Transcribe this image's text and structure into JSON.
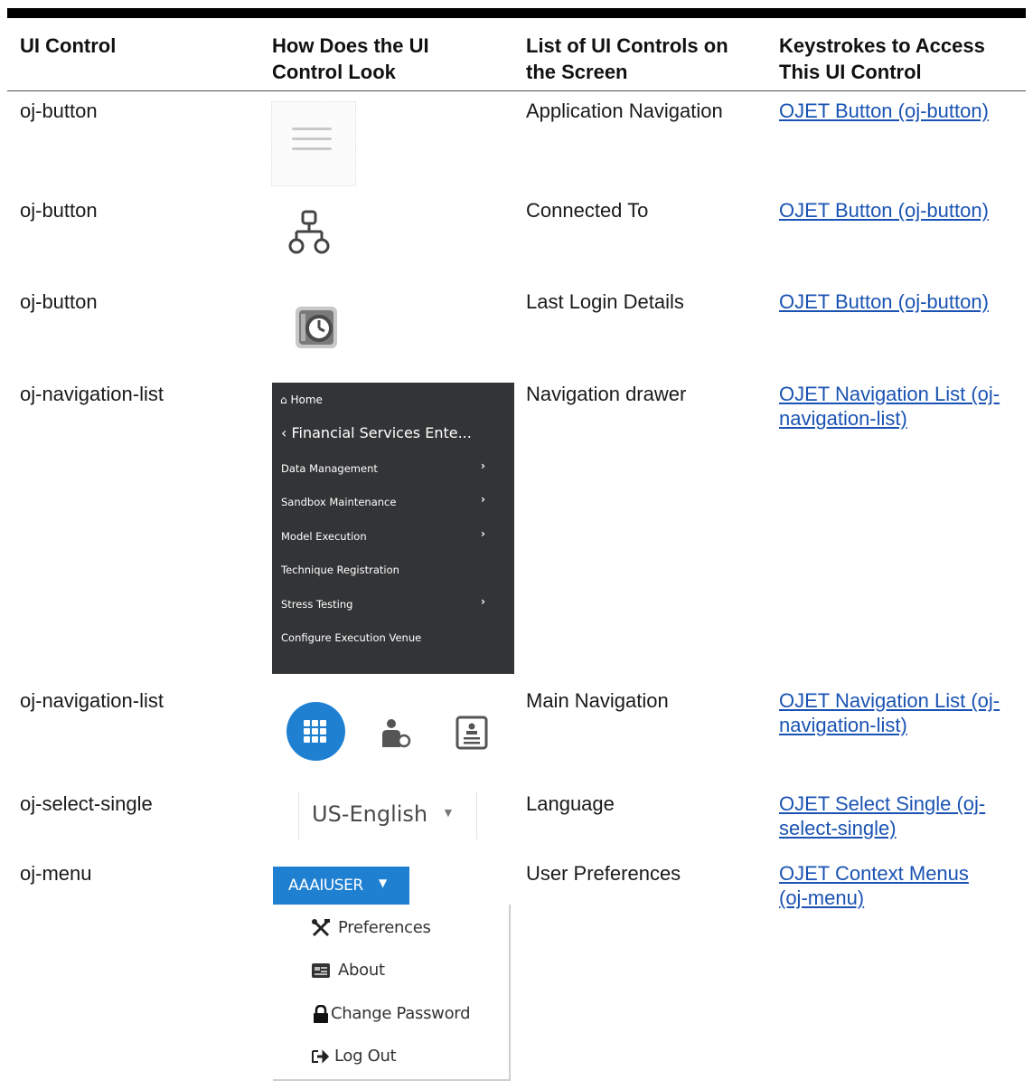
{
  "headers": {
    "col1_line1": "UI Control",
    "col2_line1": "How Does the UI",
    "col2_line2": "Control Look",
    "col3_line1": "List of UI Controls on",
    "col3_line2": "the Screen",
    "col4_line1": "Keystrokes to Access",
    "col4_line2": "This UI Control"
  },
  "rows": [
    {
      "control": "oj-button",
      "screen": "Application Navigation",
      "link1": "OJET Button (oj-button)",
      "link2": ""
    },
    {
      "control": "oj-button",
      "screen": "Connected To",
      "link1": "OJET Button (oj-button)",
      "link2": ""
    },
    {
      "control": "oj-button",
      "screen": "Last Login Details",
      "link1": "OJET Button (oj-button)",
      "link2": ""
    },
    {
      "control": "oj-navigation-list",
      "screen": "Navigation drawer",
      "link1": "OJET Navigation List (oj-",
      "link2": "navigation-list)"
    },
    {
      "control": "oj-navigation-list",
      "screen": "Main Navigation",
      "link1": "OJET Navigation List (oj-",
      "link2": "navigation-list)"
    },
    {
      "control": "oj-select-single",
      "screen": "Language",
      "link1": "OJET Select Single (oj-",
      "link2": "select-single)"
    },
    {
      "control": "oj-menu",
      "screen": "User Preferences",
      "link1": "OJET Context Menus",
      "link2": "(oj-menu)"
    }
  ],
  "drawer": {
    "home": "Home",
    "breadcrumb": "Financial Services Ente...",
    "items": [
      {
        "label": "Data Management",
        "chevron": "›"
      },
      {
        "label": "Sandbox Maintenance",
        "chevron": "›"
      },
      {
        "label": "Model Execution",
        "chevron": "›"
      },
      {
        "label": "Technique Registration",
        "chevron": ""
      },
      {
        "label": "Stress Testing",
        "chevron": "›"
      },
      {
        "label": "Configure Execution Venue",
        "chevron": ""
      }
    ]
  },
  "language_select": {
    "value": "US-English"
  },
  "user_menu": {
    "button_label": "AAAIUSER",
    "items": [
      "Preferences",
      "About",
      "Change Password",
      "Log Out"
    ]
  },
  "icons": {
    "row1": "hamburger-icon",
    "row2": "hierarchy-icon",
    "row3": "clock-icon",
    "main_nav": [
      "app-grid-icon",
      "user-settings-icon",
      "document-icon"
    ]
  },
  "colors": {
    "accent": "#1f7fd1",
    "link": "#1a53b3",
    "drawer_bg": "#333436"
  }
}
